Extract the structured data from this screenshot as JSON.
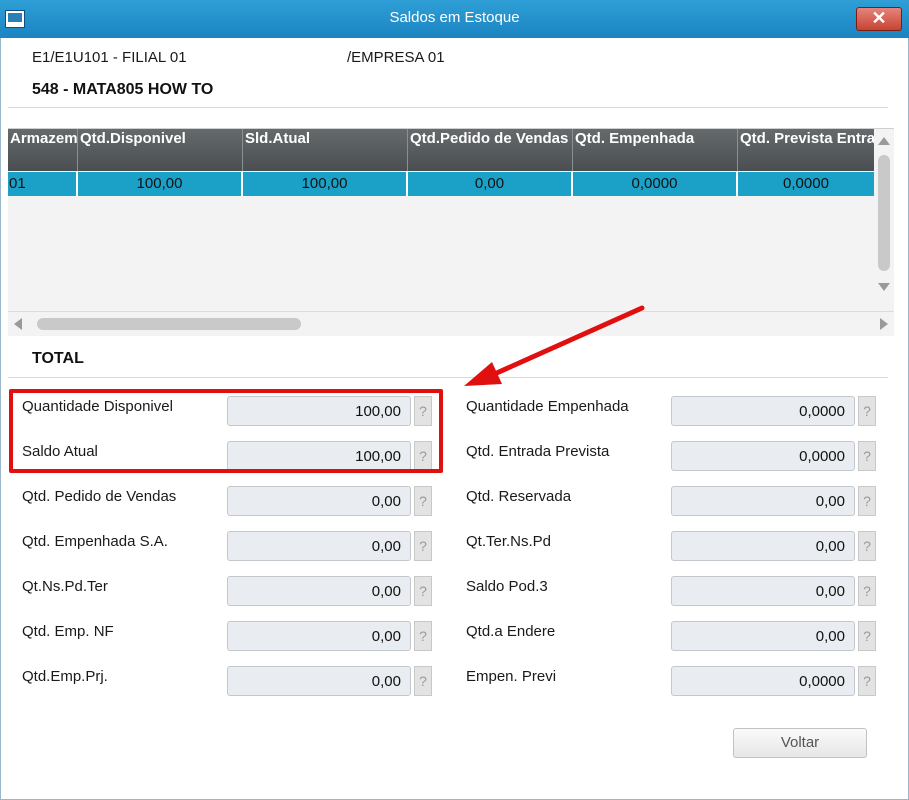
{
  "window": {
    "title": "Saldos em Estoque",
    "close_glyph": "✕"
  },
  "header": {
    "branch": "E1/E1U101 - FILIAL 01",
    "company": "/EMPRESA 01",
    "product": "548 - MATA805 HOW TO"
  },
  "grid": {
    "columns": [
      "Armazem",
      "Qtd.Disponivel",
      "Sld.Atual",
      "Qtd.Pedido de Vendas",
      "Qtd. Empenhada",
      "Qtd. Prevista Entrada"
    ],
    "rows": [
      [
        "01",
        "100,00",
        "100,00",
        "0,00",
        "0,0000",
        "0,0000"
      ]
    ],
    "selected_row_color": "#1ba1c7",
    "header_color": "#55595c"
  },
  "total": {
    "title": "TOTAL",
    "left_fields": [
      {
        "label": "Quantidade Disponivel",
        "value": "100,00"
      },
      {
        "label": "Saldo Atual",
        "value": "100,00"
      },
      {
        "label": "Qtd. Pedido de Vendas",
        "value": "0,00"
      },
      {
        "label": "Qtd. Empenhada S.A.",
        "value": "0,00"
      },
      {
        "label": "Qt.Ns.Pd.Ter",
        "value": "0,00"
      },
      {
        "label": "Qtd. Emp. NF",
        "value": "0,00"
      },
      {
        "label": "Qtd.Emp.Prj.",
        "value": "0,00"
      }
    ],
    "right_fields": [
      {
        "label": "Quantidade Empenhada",
        "value": "0,0000"
      },
      {
        "label": "Qtd. Entrada Prevista",
        "value": "0,0000"
      },
      {
        "label": "Qtd. Reservada",
        "value": "0,00"
      },
      {
        "label": "Qt.Ter.Ns.Pd",
        "value": "0,00"
      },
      {
        "label": "Saldo Pod.3",
        "value": "0,00"
      },
      {
        "label": "Qtd.a Endere",
        "value": "0,00"
      },
      {
        "label": "Empen. Previ",
        "value": "0,0000"
      }
    ],
    "help_glyph": "?"
  },
  "annotation": {
    "highlight_color": "#e01010"
  },
  "footer": {
    "back_label": "Voltar"
  }
}
